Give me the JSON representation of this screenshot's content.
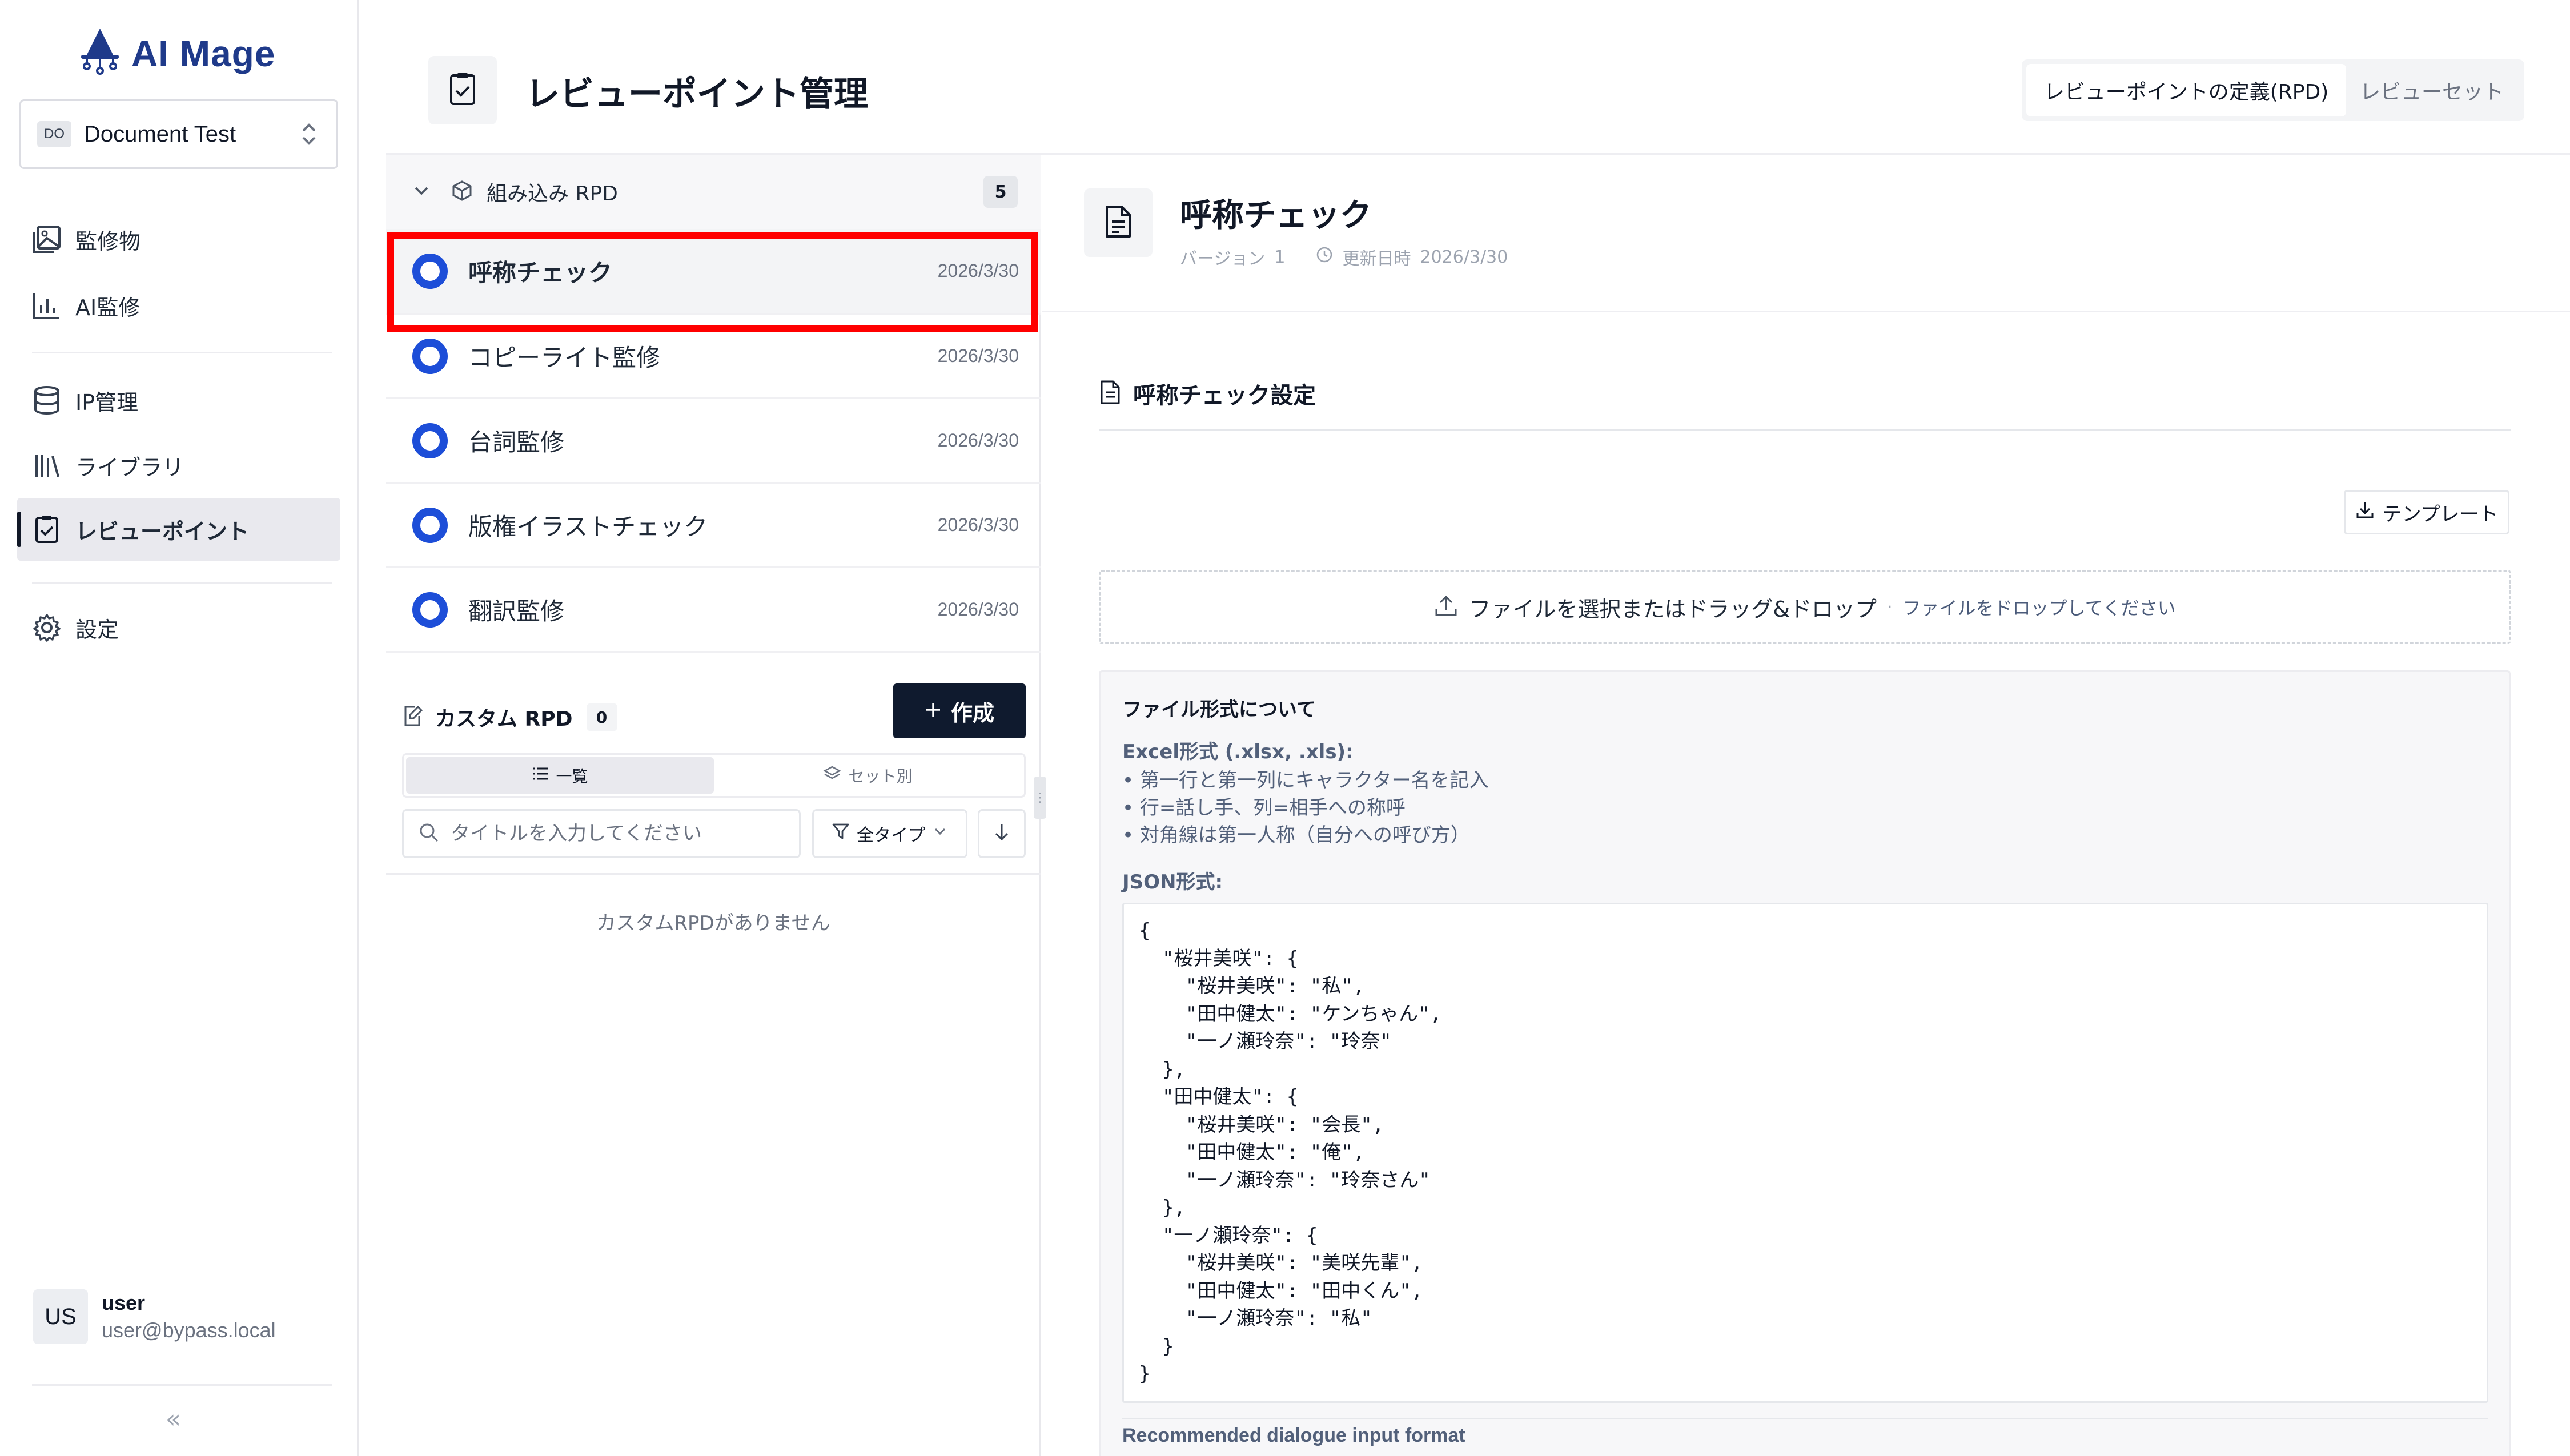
{
  "app": {
    "name": "AI Mage"
  },
  "workspace": {
    "badge": "DO",
    "name": "Document Test"
  },
  "sidebar": {
    "items": [
      {
        "label": "監修物",
        "icon": "image-gallery-icon"
      },
      {
        "label": "AI監修",
        "icon": "bar-chart-icon"
      },
      {
        "label": "IP管理",
        "icon": "database-icon"
      },
      {
        "label": "ライブラリ",
        "icon": "library-icon"
      },
      {
        "label": "レビューポイント",
        "icon": "clipboard-check-icon",
        "active": true
      },
      {
        "label": "設定",
        "icon": "gear-icon"
      }
    ]
  },
  "user": {
    "avatar": "US",
    "name": "user",
    "email": "user@bypass.local"
  },
  "collapse": {
    "label": "«"
  },
  "header": {
    "title": "レビューポイント管理",
    "toggle": [
      {
        "label": "レビューポイントの定義(RPD)",
        "active": true
      },
      {
        "label": "レビューセット",
        "active": false
      }
    ]
  },
  "builtin": {
    "label": "組み込み RPD",
    "count": "5",
    "items": [
      {
        "name": "呼称チェック",
        "date": "2026/3/30",
        "selected": true
      },
      {
        "name": "コピーライト監修",
        "date": "2026/3/30"
      },
      {
        "name": "台詞監修",
        "date": "2026/3/30"
      },
      {
        "name": "版権イラストチェック",
        "date": "2026/3/30"
      },
      {
        "name": "翻訳監修",
        "date": "2026/3/30"
      }
    ]
  },
  "custom": {
    "label": "カスタム RPD",
    "count": "0",
    "create_label": "作成",
    "tabs": [
      {
        "label": "一覧",
        "active": true
      },
      {
        "label": "セット別",
        "active": false
      }
    ],
    "search_placeholder": "タイトルを入力してください",
    "type_filter": "全タイプ",
    "empty": "カスタムRPDがありません"
  },
  "detail": {
    "title": "呼称チェック",
    "version_label": "バージョン",
    "version": "1",
    "updated_label": "更新日時",
    "updated": "2026/3/30",
    "section": "呼称チェック設定",
    "template_label": "テンプレート",
    "dropzone": {
      "main": "ファイルを選択またはドラッグ&ドロップ",
      "dot": "·",
      "sub": "ファイルをドロップしてください"
    },
    "format": {
      "title": "ファイル形式について",
      "excel_heading": "Excel形式 (.xlsx, .xls):",
      "excel_points": [
        "第一行と第一列にキャラクター名を記入",
        "行=話し手、列=相手への称呼",
        "対角線は第一人称（自分への呼び方）"
      ],
      "json_heading": "JSON形式:",
      "json_example": "{\n  \"桜井美咲\": {\n    \"桜井美咲\": \"私\",\n    \"田中健太\": \"ケンちゃん\",\n    \"一ノ瀬玲奈\": \"玲奈\"\n  },\n  \"田中健太\": {\n    \"桜井美咲\": \"会長\",\n    \"田中健太\": \"俺\",\n    \"一ノ瀬玲奈\": \"玲奈さん\"\n  },\n  \"一ノ瀬玲奈\": {\n    \"桜井美咲\": \"美咲先輩\",\n    \"田中健太\": \"田中くん\",\n    \"一ノ瀬玲奈\": \"私\"\n  }\n}",
      "recommended_heading": "Recommended dialogue input format"
    }
  },
  "colors": {
    "accent": "#1d4ed8",
    "brand": "#1f3a8a",
    "primary_button": "#0f1a2e",
    "highlight": "#ff0000"
  }
}
